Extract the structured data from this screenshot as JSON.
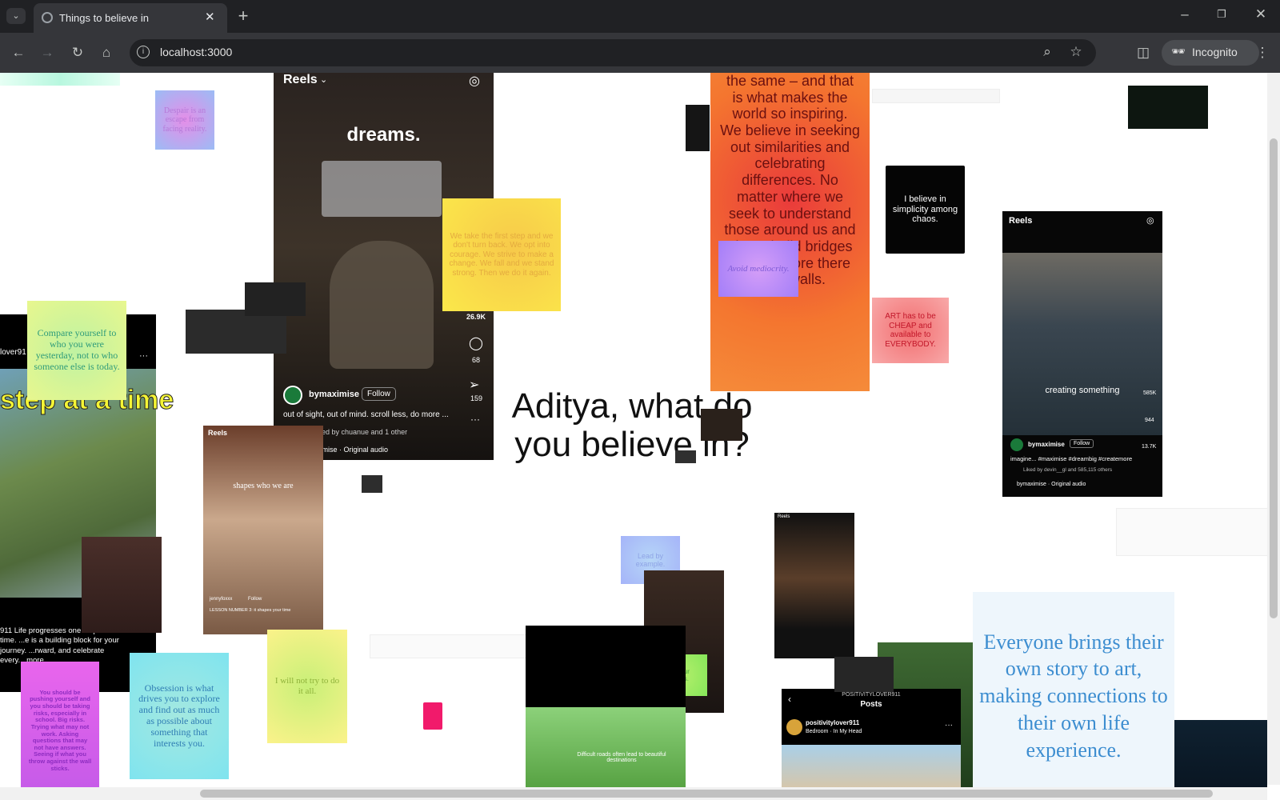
{
  "browser": {
    "tab_title": "Things to believe in",
    "url": "localhost:3000",
    "profile_label": "Incognito"
  },
  "center": {
    "headline": "Aditya, what do you believe in?"
  },
  "notes": {
    "despair": "Despair is an escape from facing reality.",
    "first_step": "We take the first step and we don't turn back. We opt into courage. We strive to make a change. We fall and we stand strong. Then we do it again.",
    "compare": "Compare yourself to who you were yesterday, not to who someone else is today.",
    "same": "the same – and that is what makes the world so inspiring. We believe in seeking out similarities and celebrating differences. No matter where we seek to understand those around us and aim to build bridges where before there were walls.",
    "avoid": "Avoid mediocrity.",
    "simplicity": "I believe in simplicity among chaos.",
    "art": "ART has to be CHEAP and available to EVERYBODY.",
    "lead": "Lead by example.",
    "colours": "Eat your colours.",
    "will_not": "I will not try to do it all.",
    "obsession": "Obsession is what drives you to explore and find out as much as possible about something that interests you.",
    "pushing": "You should be pushing yourself and you should be taking risks, especially in school. Big risks. Trying what may not work. Asking questions that may not have answers. Seeing if what you throw against the wall sticks.",
    "everyone": "Everyone brings their own story to art, making connections to their own life experience."
  },
  "reel_main": {
    "header": "Reels",
    "overlay": "dreams.",
    "user": "bymaximise",
    "follow": "Follow",
    "caption": "out of sight, out of mind. scroll less, do more ...",
    "followed": "Followed by chuanue and 1 other",
    "audio": "bymaximise · Original audio",
    "likes": "26.9K",
    "comments": "68",
    "shares": "159"
  },
  "reel_right": {
    "header": "Reels",
    "overlay": "creating something",
    "user": "bymaximise",
    "follow": "Follow",
    "caption": "imagine... #maximise #dreambig #createmore",
    "liked": "Liked by devin__gl and 585,115 others",
    "audio": "bymaximise · Original audio",
    "likes": "585K",
    "comments": "944",
    "shares": "13.7K"
  },
  "reel_small": {
    "header": "Reels",
    "overlay": "shapes who we are",
    "user": "jennyfoxxx",
    "follow": "Follow",
    "caption": "LESSON NUMBER 3: it shapes your time"
  },
  "left_post": {
    "overlay": "step at a time",
    "user": "lover91",
    "caption": "911 Life progresses one step at a time. ...e is a building block for your journey. ...rward, and celebrate every... more"
  },
  "posts_panel": {
    "account": "POSITIVITYLOVER911",
    "title": "Posts",
    "user": "positivitylover911",
    "audio": "Bedroom · In My Head"
  },
  "anime": {
    "subtitle": "Difficult roads often lead to beautiful destinations"
  }
}
